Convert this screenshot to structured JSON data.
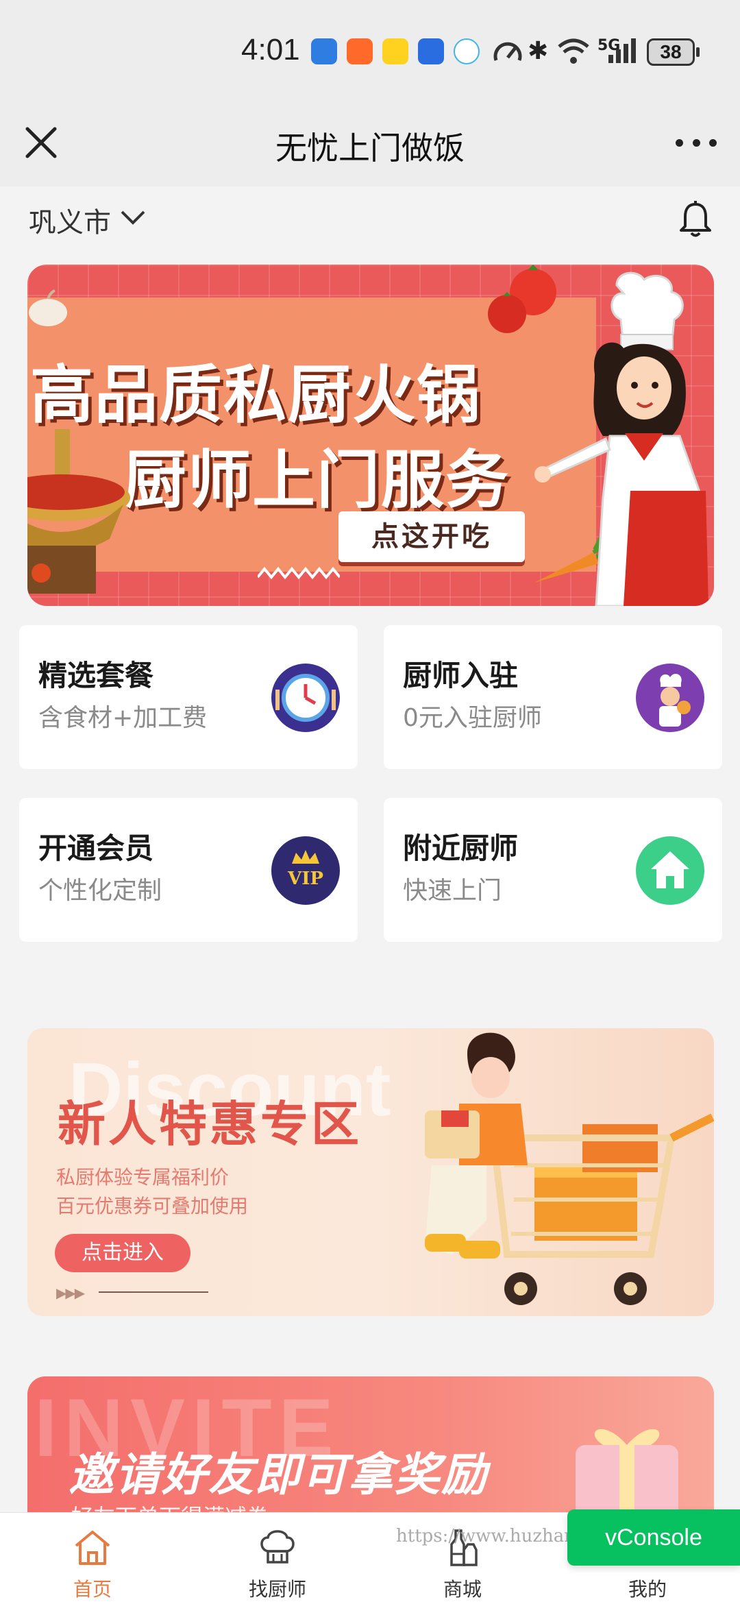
{
  "status_bar": {
    "time": "4:01",
    "network": "5G",
    "battery": "38"
  },
  "nav": {
    "title": "无忧上门做饭"
  },
  "location": {
    "city": "巩义市"
  },
  "banner": {
    "line1": "高品质私厨火锅",
    "line2": "厨师上门服务",
    "cta": "点这开吃"
  },
  "cards": [
    {
      "title": "精选套餐",
      "subtitle": "含食材+加工费",
      "icon": "clock-icon",
      "color": "#3b2f8f"
    },
    {
      "title": "厨师入驻",
      "subtitle": "0元入驻厨师",
      "icon": "chef-icon",
      "color": "#7d3fb0"
    },
    {
      "title": "开通会员",
      "subtitle": "个性化定制",
      "icon": "vip-icon",
      "color": "#2f2a6f"
    },
    {
      "title": "附近厨师",
      "subtitle": "快速上门",
      "icon": "home-icon",
      "color": "#3ccf8a"
    }
  ],
  "promo_new_user": {
    "ghost": "Discount",
    "title": "新人特惠专区",
    "sub1": "私厨体验专属福利价",
    "sub2": "百元优惠券可叠加使用",
    "button": "点击进入",
    "arrows": "▶▶▶"
  },
  "promo_invite": {
    "ghost": "INVITE",
    "title": "邀请好友即可拿奖励",
    "subtitle": "好友下单下得满减卷"
  },
  "tabs": [
    {
      "label": "首页",
      "icon": "home-tab-icon",
      "active": true
    },
    {
      "label": "找厨师",
      "icon": "chef-hat-icon",
      "active": false
    },
    {
      "label": "商城",
      "icon": "bottles-icon",
      "active": false
    },
    {
      "label": "我的",
      "icon": "user-icon",
      "active": false
    }
  ],
  "vconsole": "vConsole",
  "watermark": "https://www.huzhan.com/ishop"
}
